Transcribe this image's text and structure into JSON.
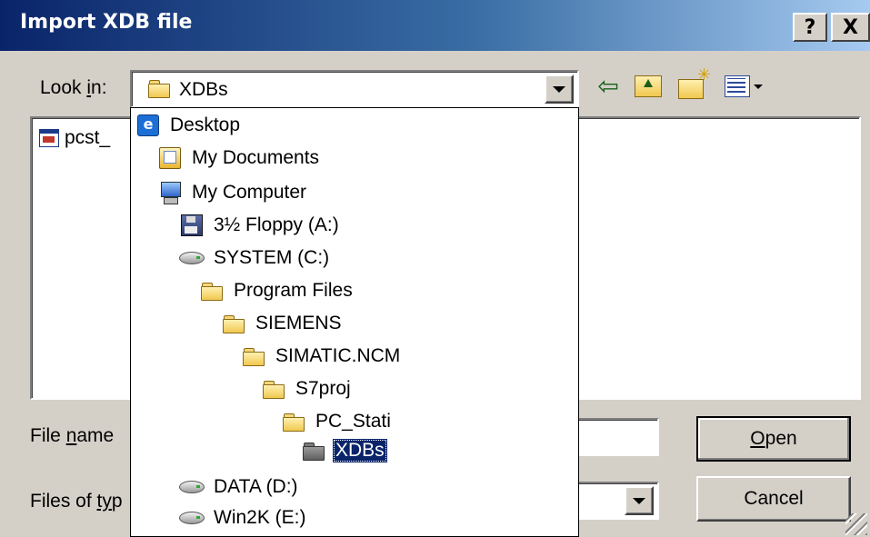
{
  "title": "Import XDB file",
  "caption_buttons": {
    "help": "?",
    "close": "X"
  },
  "look_in": {
    "label_pre": "Look ",
    "label_accel": "i",
    "label_post": "n:",
    "value": "XDBs"
  },
  "file_list": {
    "items": [
      {
        "name": "pcst_"
      }
    ]
  },
  "file_name": {
    "label_pre": "File ",
    "label_accel": "n",
    "label_post": "ame",
    "value": ""
  },
  "files_of_type": {
    "label_pre": "Files of ",
    "label_accel": "ty",
    "label_post": "p",
    "value": ""
  },
  "buttons": {
    "open_accel": "O",
    "open_rest": "pen",
    "cancel": "Cancel"
  },
  "dropdown": {
    "items": [
      {
        "label": "Desktop",
        "icon": "desktop-icon",
        "level": 0,
        "selected": false
      },
      {
        "label": "My Documents",
        "icon": "my-documents-icon",
        "level": 1,
        "selected": false
      },
      {
        "label": "My Computer",
        "icon": "my-computer-icon",
        "level": 1,
        "selected": false
      },
      {
        "label": "3½ Floppy (A:)",
        "icon": "floppy-icon",
        "level": 2,
        "selected": false
      },
      {
        "label": "SYSTEM (C:)",
        "icon": "hard-drive-icon",
        "level": 2,
        "selected": false
      },
      {
        "label": "Program Files",
        "icon": "folder-icon",
        "level": 3,
        "selected": false
      },
      {
        "label": "SIEMENS",
        "icon": "folder-icon",
        "level": 4,
        "selected": false
      },
      {
        "label": "SIMATIC.NCM",
        "icon": "folder-icon",
        "level": 5,
        "selected": false
      },
      {
        "label": "S7proj",
        "icon": "folder-icon",
        "level": 6,
        "selected": false
      },
      {
        "label": "PC_Stati",
        "icon": "folder-icon",
        "level": 7,
        "selected": false
      },
      {
        "label": "XDBs",
        "icon": "open-folder-icon",
        "level": 8,
        "selected": true
      },
      {
        "label": "DATA (D:)",
        "icon": "hard-drive-icon",
        "level": 2,
        "selected": false
      },
      {
        "label": "Win2K (E:)",
        "icon": "hard-drive-icon",
        "level": 2,
        "selected": false
      }
    ]
  },
  "colors": {
    "titlebar_start": "#0a246a",
    "titlebar_end": "#a6caf0",
    "selection": "#0a246a",
    "face": "#d4d0c8"
  }
}
